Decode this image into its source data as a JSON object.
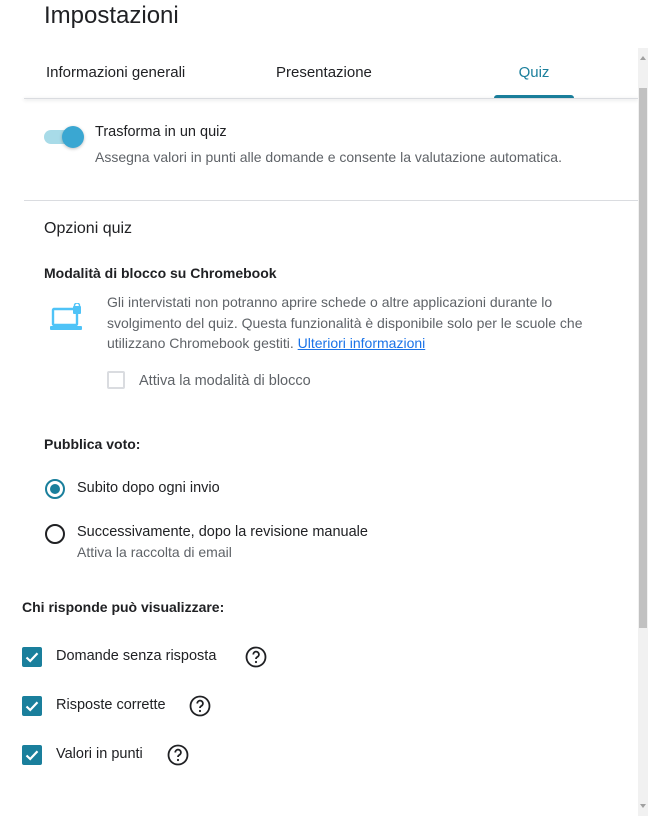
{
  "dialog": {
    "title": "Impostazioni"
  },
  "tabs": [
    {
      "label": "Informazioni generali"
    },
    {
      "label": "Presentazione"
    },
    {
      "label": "Quiz"
    }
  ],
  "quiz_toggle": {
    "label": "Trasforma in un quiz",
    "description": "Assegna valori in punti alle domande e consente la valutazione automatica.",
    "enabled": true
  },
  "quiz_options": {
    "heading": "Opzioni quiz",
    "lock_mode": {
      "heading": "Modalità di blocco su Chromebook",
      "description": "Gli intervistati non potranno aprire schede o altre applicazioni durante lo svolgimento del quiz. Questa funzionalità è disponibile solo per le scuole che utilizzano Chromebook gestiti.",
      "link": "Ulteriori informazioni",
      "checkbox_label": "Attiva la modalità di blocco"
    },
    "publish_grade": {
      "heading": "Pubblica voto:",
      "option_immediate": "Subito dopo ogni invio",
      "option_later": "Successivamente, dopo la revisione manuale",
      "option_later_note": "Attiva la raccolta di email"
    },
    "respondent_view": {
      "heading": "Chi risponde può visualizzare:",
      "items": [
        {
          "label": "Domande senza risposta"
        },
        {
          "label": "Risposte corrette"
        },
        {
          "label": "Valori in punti"
        }
      ]
    }
  },
  "colors": {
    "accent": "#1a7f9c",
    "toggle_knob": "#3aa7d2",
    "link": "#1a73e8",
    "laptop_icon": "#4fc3f7"
  }
}
